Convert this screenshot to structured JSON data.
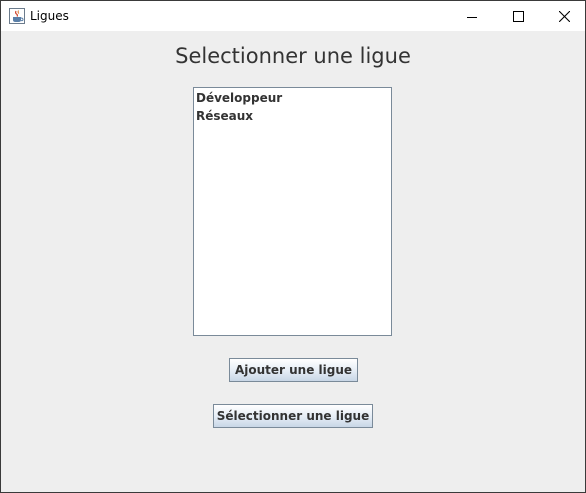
{
  "window": {
    "title": "Ligues",
    "icon": "java-cup-icon",
    "controls": [
      "minimize-icon",
      "maximize-icon",
      "close-icon"
    ]
  },
  "main": {
    "heading": "Selectionner une ligue",
    "list": {
      "items": [
        "Développeur",
        "Réseaux"
      ]
    },
    "buttons": {
      "add_label": "Ajouter une ligue",
      "select_label": "Sélectionner une ligue"
    }
  },
  "colors": {
    "window_background": "#eeeeee",
    "titlebar_background": "#ffffff",
    "list_background": "#ffffff",
    "border": "#7a8a99",
    "text": "#333333"
  }
}
